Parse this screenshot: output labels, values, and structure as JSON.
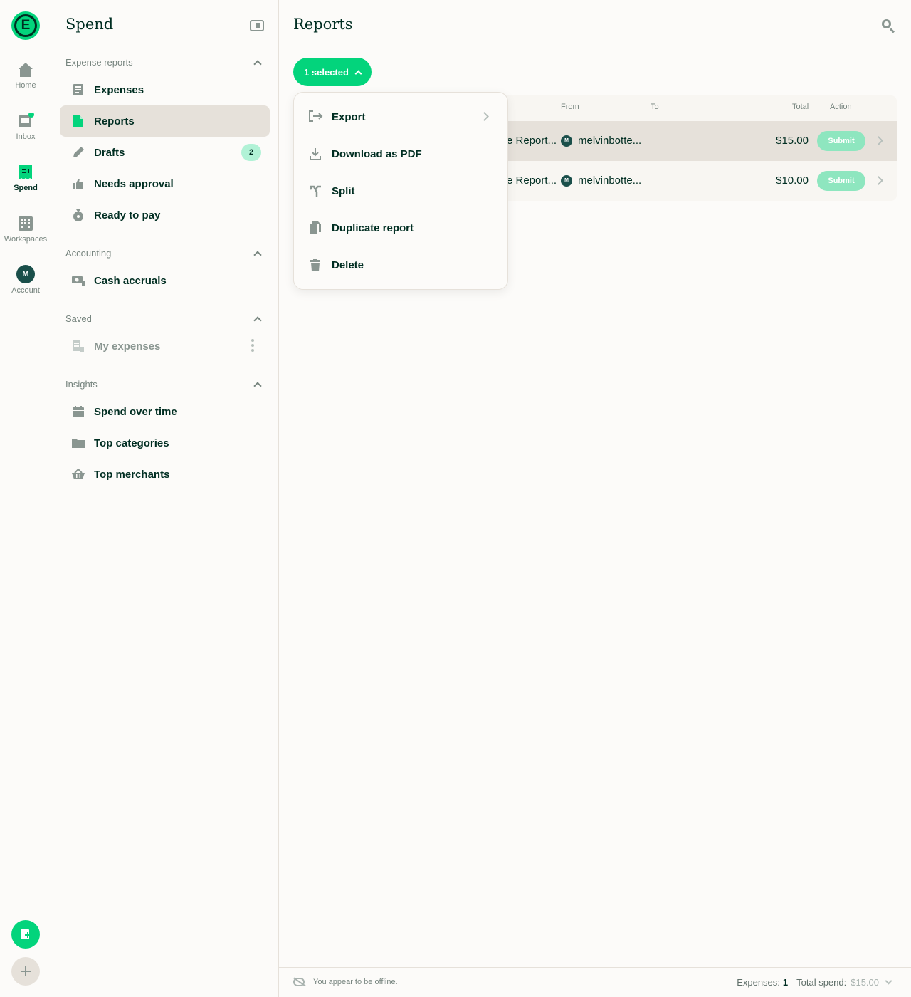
{
  "rail": {
    "items": [
      {
        "label": "Home",
        "icon": "home-icon"
      },
      {
        "label": "Inbox",
        "icon": "inbox-icon"
      },
      {
        "label": "Spend",
        "icon": "receipt-icon"
      },
      {
        "label": "Workspaces",
        "icon": "building-icon"
      },
      {
        "label": "Account",
        "icon": "avatar"
      }
    ],
    "avatar_initial": "M"
  },
  "sidebar": {
    "title": "Spend",
    "sections": [
      {
        "title": "Expense reports",
        "items": [
          {
            "label": "Expenses"
          },
          {
            "label": "Reports"
          },
          {
            "label": "Drafts",
            "badge": "2"
          },
          {
            "label": "Needs approval"
          },
          {
            "label": "Ready to pay"
          }
        ]
      },
      {
        "title": "Accounting",
        "items": [
          {
            "label": "Cash accruals"
          }
        ]
      },
      {
        "title": "Saved",
        "items": [
          {
            "label": "My expenses"
          }
        ]
      },
      {
        "title": "Insights",
        "items": [
          {
            "label": "Spend over time"
          },
          {
            "label": "Top categories"
          },
          {
            "label": "Top merchants"
          }
        ]
      }
    ]
  },
  "main": {
    "title": "Reports",
    "selected_label": "1 selected",
    "columns": {
      "from": "From",
      "to": "To",
      "total": "Total",
      "action": "Action"
    },
    "rows": [
      {
        "name": "e Report...",
        "from": "melvinbotte...",
        "avatar": "M",
        "total": "$15.00",
        "action": "Submit"
      },
      {
        "name": "e Report...",
        "from": "melvinbotte...",
        "avatar": "M",
        "total": "$10.00",
        "action": "Submit"
      }
    ],
    "menu": [
      {
        "label": "Export",
        "icon": "export-icon"
      },
      {
        "label": "Download as PDF",
        "icon": "download-icon"
      },
      {
        "label": "Split",
        "icon": "split-icon"
      },
      {
        "label": "Duplicate report",
        "icon": "duplicate-icon"
      },
      {
        "label": "Delete",
        "icon": "trash-icon"
      }
    ]
  },
  "footer": {
    "offline": "You appear to be offline.",
    "expenses_label": "Expenses:",
    "expenses_count": "1",
    "total_label": "Total spend:",
    "total_value": "$15.00"
  },
  "colors": {
    "accent": "#03d47c",
    "text": "#002e22",
    "muted": "#76847e",
    "selected_bg": "#e6e1da"
  }
}
